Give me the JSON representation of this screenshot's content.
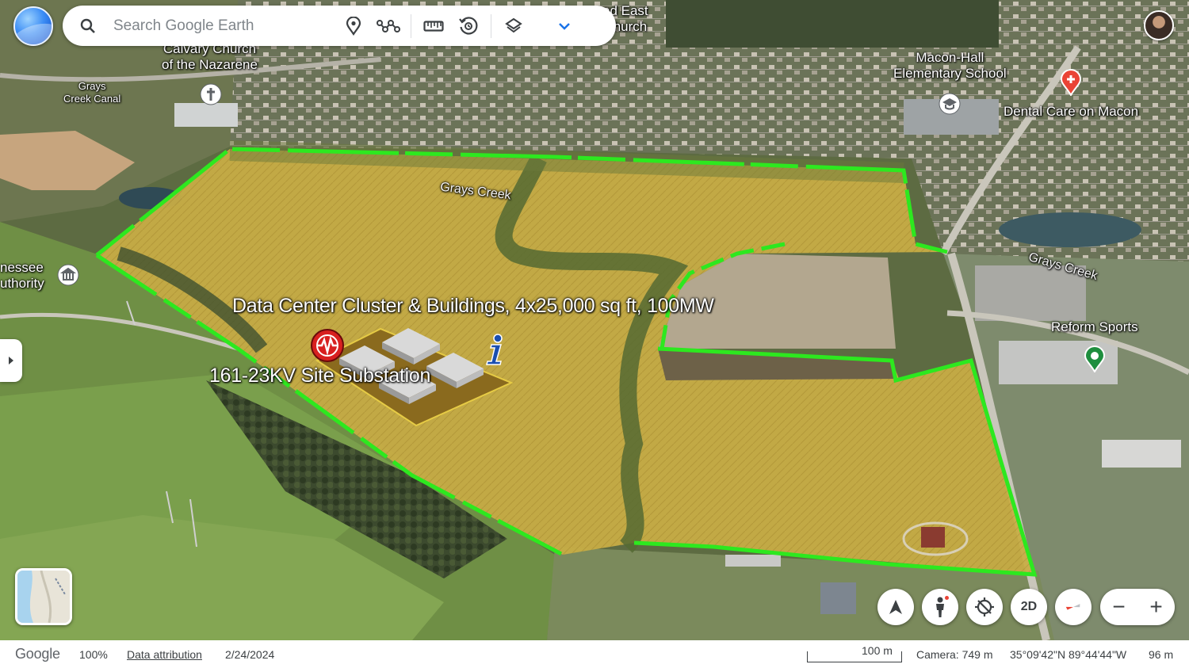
{
  "search": {
    "placeholder": "Search Google Earth"
  },
  "toolbar": {
    "items": [
      {
        "icon": "place-pin-icon"
      },
      {
        "icon": "path-icon"
      },
      {
        "icon": "ruler-icon"
      },
      {
        "icon": "history-icon"
      },
      {
        "icon": "layers-icon"
      },
      {
        "icon": "chevron-down-icon"
      }
    ]
  },
  "map": {
    "places": {
      "calvary": "Calvary Church\nof the Nazarene",
      "east_church": "od East\nChurch",
      "grays_canal": "Grays\nCreek Canal",
      "macon_hall": "Macon-Hall\nElementary School",
      "dental": "Dental Care on Macon",
      "grays_creek_1": "Grays Creek",
      "grays_creek_2": "Grays Creek",
      "authority": "nessee\nuthority",
      "reform": "Reform Sports"
    },
    "annotations": {
      "data_center": "Data Center Cluster & Buildings, 4x25,000 sq ft, 100MW",
      "substation": "161-23KV Site Substation"
    }
  },
  "controls": {
    "view_mode": "2D",
    "zoom_out": "−",
    "zoom_in": "+"
  },
  "status": {
    "brand": "Google",
    "zoom": "100%",
    "attribution": "Data attribution",
    "date": "2/24/2024",
    "scale": "100 m",
    "camera": "Camera: 749 m",
    "coords": "35°09'42\"N 89°44'44\"W",
    "elevation": "96 m"
  },
  "colors": {
    "boundary": "#2de81f",
    "parcel_fill": "#c9ad3e",
    "pad_fill": "#8a6a1e",
    "accent": "#1a73e8"
  }
}
